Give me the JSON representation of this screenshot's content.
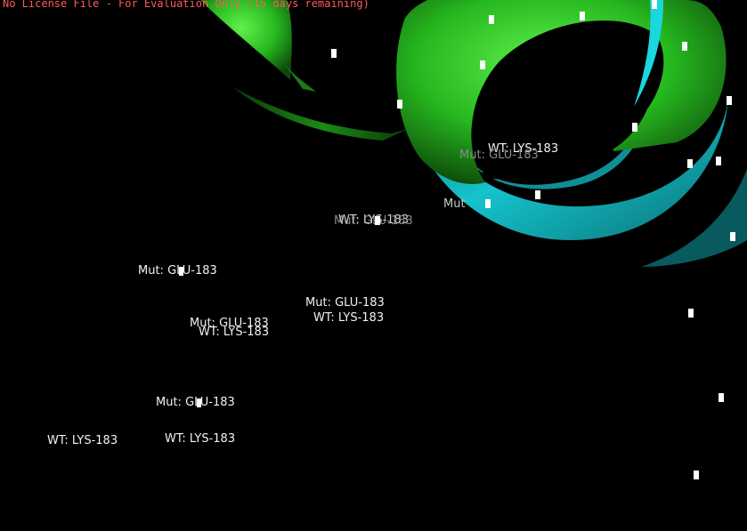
{
  "viewer": {
    "license_notice": "No License File - For Evaluation Only (15 days remaining)",
    "colors": {
      "background": "#000000",
      "notice": "#ff5a5a",
      "ribbon_green": "#2fd02a",
      "ribbon_cyan": "#12b9bf",
      "label_text": "#f2f2f2",
      "atom_marker": "#ffffff"
    }
  },
  "scene": {
    "ribbon_names": [
      "green-helix-ribbon",
      "cyan-helix-ribbon",
      "green-strand-ribbon"
    ],
    "atom_marker_count": 20
  },
  "labels": [
    {
      "text": "WT: LYS-183"
    },
    {
      "text": "Mut: GLU-183"
    },
    {
      "text": "Mut: GLU-183"
    },
    {
      "text": "WT: LYS-183"
    },
    {
      "text": "Mut: GLU-183"
    },
    {
      "text": "Mut: GLU-183"
    },
    {
      "text": "Mut: GLU-183"
    },
    {
      "text": "WT: LYS-183"
    },
    {
      "text": "Mut: GLU-183"
    },
    {
      "text": "WT: LYS-183"
    },
    {
      "text": "Mut: GLU-183"
    },
    {
      "text": "WT: LYS-183"
    },
    {
      "text": "WT: LYS-183"
    },
    {
      "text": "Mut"
    }
  ]
}
